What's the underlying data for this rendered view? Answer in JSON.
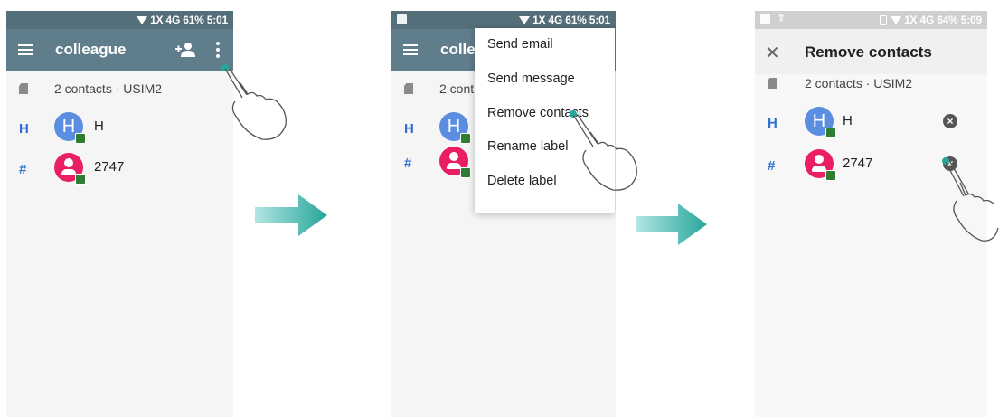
{
  "screens": [
    {
      "status": {
        "text": "1X 4G 61% 5:01"
      },
      "toolbar": {
        "title": "colleague"
      },
      "info": "2 contacts · USIM2",
      "contacts": [
        {
          "index_letter": "H",
          "avatar_letter": "H",
          "name": "H",
          "avatar": "blue"
        },
        {
          "index_letter": "#",
          "avatar_letter": "",
          "name": "2747",
          "avatar": "red"
        }
      ]
    },
    {
      "status": {
        "text": "1X 4G 61% 5:01"
      },
      "toolbar": {
        "title": "colle"
      },
      "info": "2 cont",
      "contacts": [
        {
          "index_letter": "H",
          "avatar_letter": "H"
        },
        {
          "index_letter": "#",
          "avatar_letter": ""
        }
      ],
      "menu": [
        "Send email",
        "Send message",
        "Remove contacts",
        "Rename label",
        "Delete label"
      ]
    },
    {
      "status": {
        "text": "1X 4G 64% 5:09"
      },
      "toolbar": {
        "title": "Remove contacts"
      },
      "info": "2 contacts · USIM2",
      "contacts": [
        {
          "index_letter": "H",
          "avatar_letter": "H",
          "name": "H",
          "avatar": "blue"
        },
        {
          "index_letter": "#",
          "avatar_letter": "",
          "name": "2747",
          "avatar": "red"
        }
      ]
    }
  ],
  "icons": {
    "menu": "hamburger-icon",
    "add_contact": "person-add-icon",
    "more": "more-vert-icon",
    "close": "close-icon",
    "sim": "sim-card-icon",
    "remove": "remove-circle-icon",
    "arrow": "right-arrow",
    "hand": "pointing-hand"
  },
  "colors": {
    "toolbar": "#607d8b",
    "statusbar": "#546e7a",
    "accent_blue": "#2f6fd1",
    "avatar_blue": "#5b8ee0",
    "avatar_red": "#e91e63",
    "arrow": "#26a69a"
  }
}
